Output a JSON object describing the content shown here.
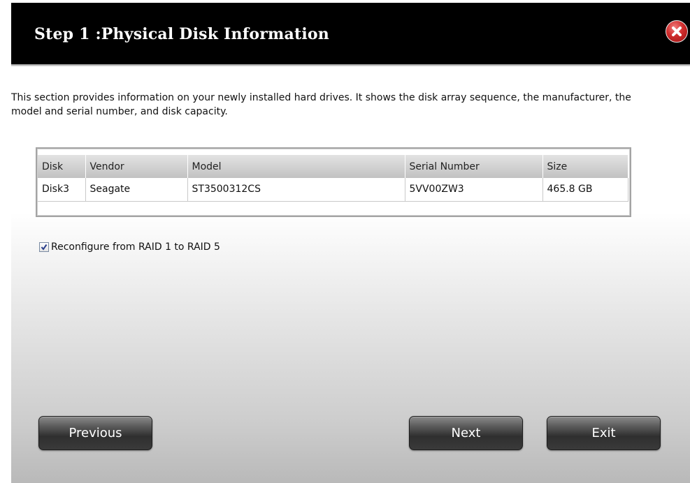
{
  "dialog": {
    "title": "Step 1 :Physical Disk Information",
    "close_icon": "close-icon",
    "description": "This section provides information on your newly installed hard drives. It shows the disk array sequence, the manufacturer, the model and serial number, and disk capacity."
  },
  "table": {
    "headers": [
      "Disk",
      "Vendor",
      "Model",
      "Serial Number",
      "Size"
    ],
    "rows": [
      [
        "Disk3",
        "Seagate",
        "ST3500312CS",
        "5VV00ZW3",
        "465.8 GB"
      ]
    ]
  },
  "reconfigure": {
    "checked": true,
    "label": "Reconfigure from RAID 1 to RAID 5"
  },
  "buttons": {
    "previous": "Previous",
    "next": "Next",
    "exit": "Exit"
  }
}
